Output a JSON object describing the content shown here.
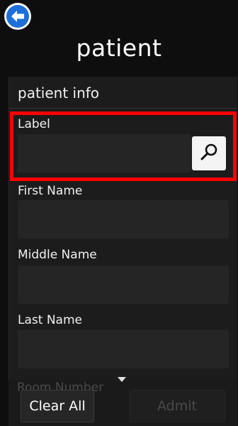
{
  "header": {
    "back_icon": "arrow-left-icon",
    "title": "patient"
  },
  "section": {
    "title": "patient info"
  },
  "fields": [
    {
      "label": "Label",
      "value": "",
      "placeholder": ""
    },
    {
      "label": "First Name",
      "value": "",
      "placeholder": ""
    },
    {
      "label": "Middle Name",
      "value": "",
      "placeholder": ""
    },
    {
      "label": "Last Name",
      "value": "",
      "placeholder": ""
    },
    {
      "label": "Room Number",
      "value": "",
      "placeholder": ""
    }
  ],
  "search_icon": "search-icon",
  "footer": {
    "clear_all_label": "Clear All",
    "admit_label": "Admit"
  },
  "colors": {
    "highlight": "#ff0000",
    "accent_back": "#1e6fd9"
  }
}
